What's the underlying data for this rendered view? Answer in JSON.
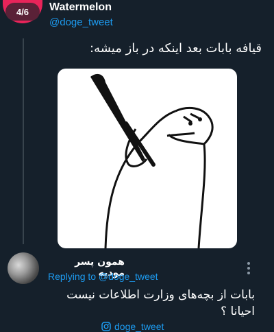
{
  "thread": {
    "position": "4/6"
  },
  "tweet": {
    "author_name": "Watermelon",
    "author_handle": "@doge_tweet",
    "text": "قیافه بابات بعد اینکه در باز میشه:"
  },
  "reply": {
    "author_name": "همون پسر مودیه",
    "replying_to": "Replying to @doge_tweet",
    "text_line1": "بابات از بچه‌های وزارت اطلاعات نیست",
    "text_line2": "احیانا ؟"
  },
  "watermark": {
    "icon": "instagram-icon",
    "handle": "doge_tweet"
  },
  "colors": {
    "background": "#15202b",
    "accent": "#1d9bf0",
    "badge": "#e8245a"
  }
}
